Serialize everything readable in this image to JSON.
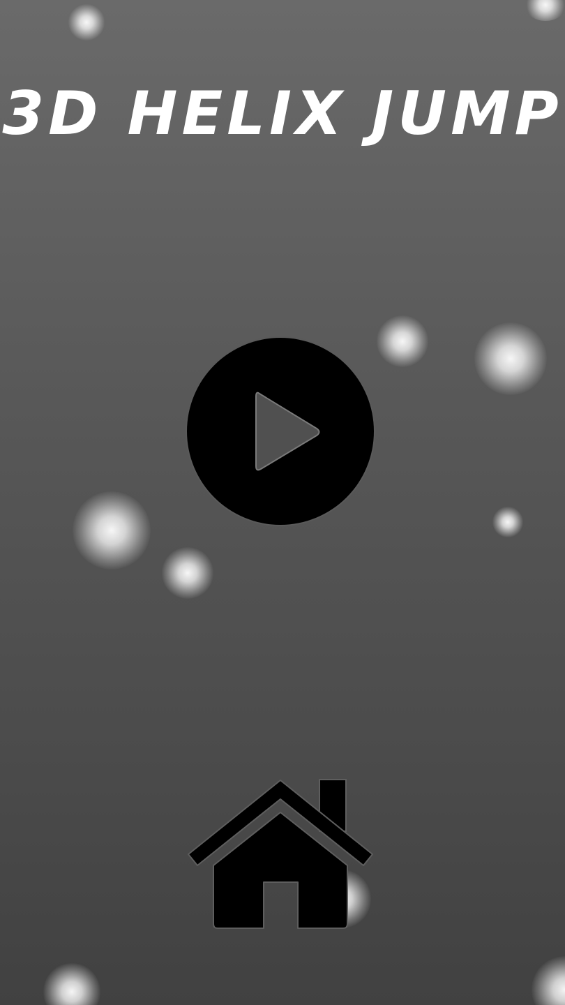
{
  "game": {
    "title": "3D HELIX JUMP"
  },
  "controls": {
    "play_icon": "play-icon",
    "home_icon": "home-icon"
  },
  "colors": {
    "background_top": "#6a6a6a",
    "background_bottom": "#414141",
    "title": "#ffffff",
    "buttons": "#000000",
    "play_triangle": "#505050"
  }
}
